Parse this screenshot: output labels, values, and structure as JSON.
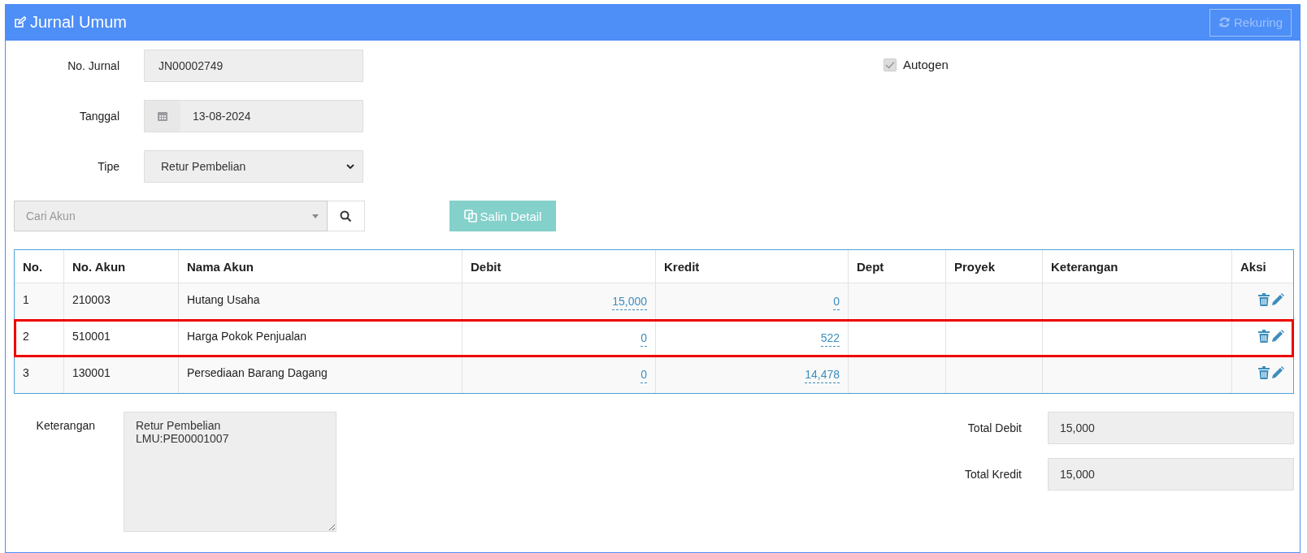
{
  "panel": {
    "title": "Jurnal Umum",
    "action_button": {
      "label": "Rekuring",
      "disabled": true
    }
  },
  "form": {
    "no_jurnal": {
      "label": "No. Jurnal",
      "value": "JN00002749"
    },
    "tanggal": {
      "label": "Tanggal",
      "value": "13-08-2024"
    },
    "tipe": {
      "label": "Tipe",
      "value": "Retur Pembelian"
    },
    "autogen": {
      "label": "Autogen",
      "checked": true,
      "disabled": true
    }
  },
  "account_search": {
    "placeholder": "Cari Akun"
  },
  "copy_button": {
    "label": "Salin Detail"
  },
  "table": {
    "columns": [
      "No.",
      "No. Akun",
      "Nama Akun",
      "Debit",
      "Kredit",
      "Dept",
      "Proyek",
      "Keterangan",
      "Aksi"
    ],
    "rows": [
      {
        "no": "1",
        "account_no": "210003",
        "account_name": "Hutang Usaha",
        "debit": "15,000",
        "kredit": "0",
        "highlighted": false
      },
      {
        "no": "2",
        "account_no": "510001",
        "account_name": "Harga Pokok Penjualan",
        "debit": "0",
        "kredit": "522",
        "highlighted": true
      },
      {
        "no": "3",
        "account_no": "130001",
        "account_name": "Persediaan Barang Dagang",
        "debit": "0",
        "kredit": "14,478",
        "highlighted": false
      }
    ]
  },
  "footer": {
    "keterangan": {
      "label": "Keterangan",
      "value": "Retur Pembelian\nLMU:PE00001007"
    },
    "total_debit": {
      "label": "Total Debit",
      "value": "15,000"
    },
    "total_kredit": {
      "label": "Total Kredit",
      "value": "15,000"
    }
  }
}
